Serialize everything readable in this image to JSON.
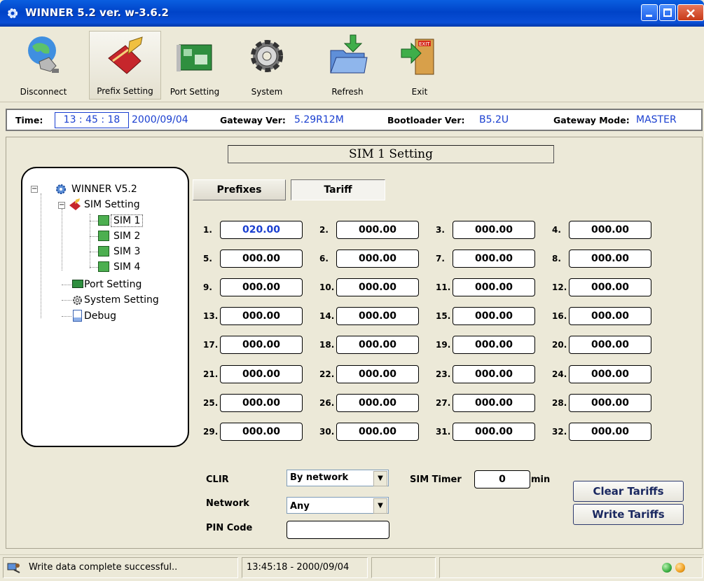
{
  "window": {
    "title": "WINNER 5.2 ver. w-3.6.2"
  },
  "toolbar": [
    {
      "label": "Disconnect",
      "icon": "disconnect-icon"
    },
    {
      "label": "Prefix Setting",
      "icon": "prefix-setting-icon"
    },
    {
      "label": "Port Setting",
      "icon": "port-setting-icon"
    },
    {
      "label": "System",
      "icon": "system-gear-icon"
    },
    {
      "label": "Refresh",
      "icon": "refresh-folder-icon"
    },
    {
      "label": "Exit",
      "icon": "exit-door-icon"
    }
  ],
  "info": {
    "time_label": "Time:",
    "time_value": "13 : 45 : 18",
    "date_value": "2000/09/04",
    "gateway_ver_label": "Gateway Ver:",
    "gateway_ver_value": "5.29R12M",
    "bootloader_label": "Bootloader Ver:",
    "bootloader_value": "B5.2U",
    "mode_label": "Gateway Mode:",
    "mode_value": "MASTER"
  },
  "panel_title": "SIM 1 Setting",
  "tree": {
    "root": "WINNER V5.2",
    "sim_setting": "SIM Setting",
    "sims": [
      "SIM 1",
      "SIM 2",
      "SIM 3",
      "SIM 4"
    ],
    "port_setting": "Port Setting",
    "system_setting": "System Setting",
    "debug": "Debug"
  },
  "tabs": {
    "prefixes": "Prefixes",
    "tariff": "Tariff"
  },
  "tariffs": [
    {
      "n": "1.",
      "v": "020.00"
    },
    {
      "n": "2.",
      "v": "000.00"
    },
    {
      "n": "3.",
      "v": "000.00"
    },
    {
      "n": "4.",
      "v": "000.00"
    },
    {
      "n": "5.",
      "v": "000.00"
    },
    {
      "n": "6.",
      "v": "000.00"
    },
    {
      "n": "7.",
      "v": "000.00"
    },
    {
      "n": "8.",
      "v": "000.00"
    },
    {
      "n": "9.",
      "v": "000.00"
    },
    {
      "n": "10.",
      "v": "000.00"
    },
    {
      "n": "11.",
      "v": "000.00"
    },
    {
      "n": "12.",
      "v": "000.00"
    },
    {
      "n": "13.",
      "v": "000.00"
    },
    {
      "n": "14.",
      "v": "000.00"
    },
    {
      "n": "15.",
      "v": "000.00"
    },
    {
      "n": "16.",
      "v": "000.00"
    },
    {
      "n": "17.",
      "v": "000.00"
    },
    {
      "n": "18.",
      "v": "000.00"
    },
    {
      "n": "19.",
      "v": "000.00"
    },
    {
      "n": "20.",
      "v": "000.00"
    },
    {
      "n": "21.",
      "v": "000.00"
    },
    {
      "n": "22.",
      "v": "000.00"
    },
    {
      "n": "23.",
      "v": "000.00"
    },
    {
      "n": "24.",
      "v": "000.00"
    },
    {
      "n": "25.",
      "v": "000.00"
    },
    {
      "n": "26.",
      "v": "000.00"
    },
    {
      "n": "27.",
      "v": "000.00"
    },
    {
      "n": "28.",
      "v": "000.00"
    },
    {
      "n": "29.",
      "v": "000.00"
    },
    {
      "n": "30.",
      "v": "000.00"
    },
    {
      "n": "31.",
      "v": "000.00"
    },
    {
      "n": "32.",
      "v": "000.00"
    }
  ],
  "settings": {
    "clir_label": "CLIR",
    "clir_value": "By network",
    "network_label": "Network",
    "network_value": "Any",
    "pin_label": "PIN Code",
    "pin_value": "",
    "sim_timer_label": "SIM Timer",
    "sim_timer_value": "0",
    "sim_timer_unit": "min"
  },
  "buttons": {
    "clear": "Clear Tariffs",
    "write": "Write Tariffs"
  },
  "status": {
    "message": "Write data complete successful..",
    "datetime": "13:45:18 - 2000/09/04",
    "led_colors": [
      "#3cb043",
      "#f0a020"
    ]
  },
  "colors": {
    "accent_blue": "#1a3fd0",
    "title_bar": "#0043c8"
  }
}
